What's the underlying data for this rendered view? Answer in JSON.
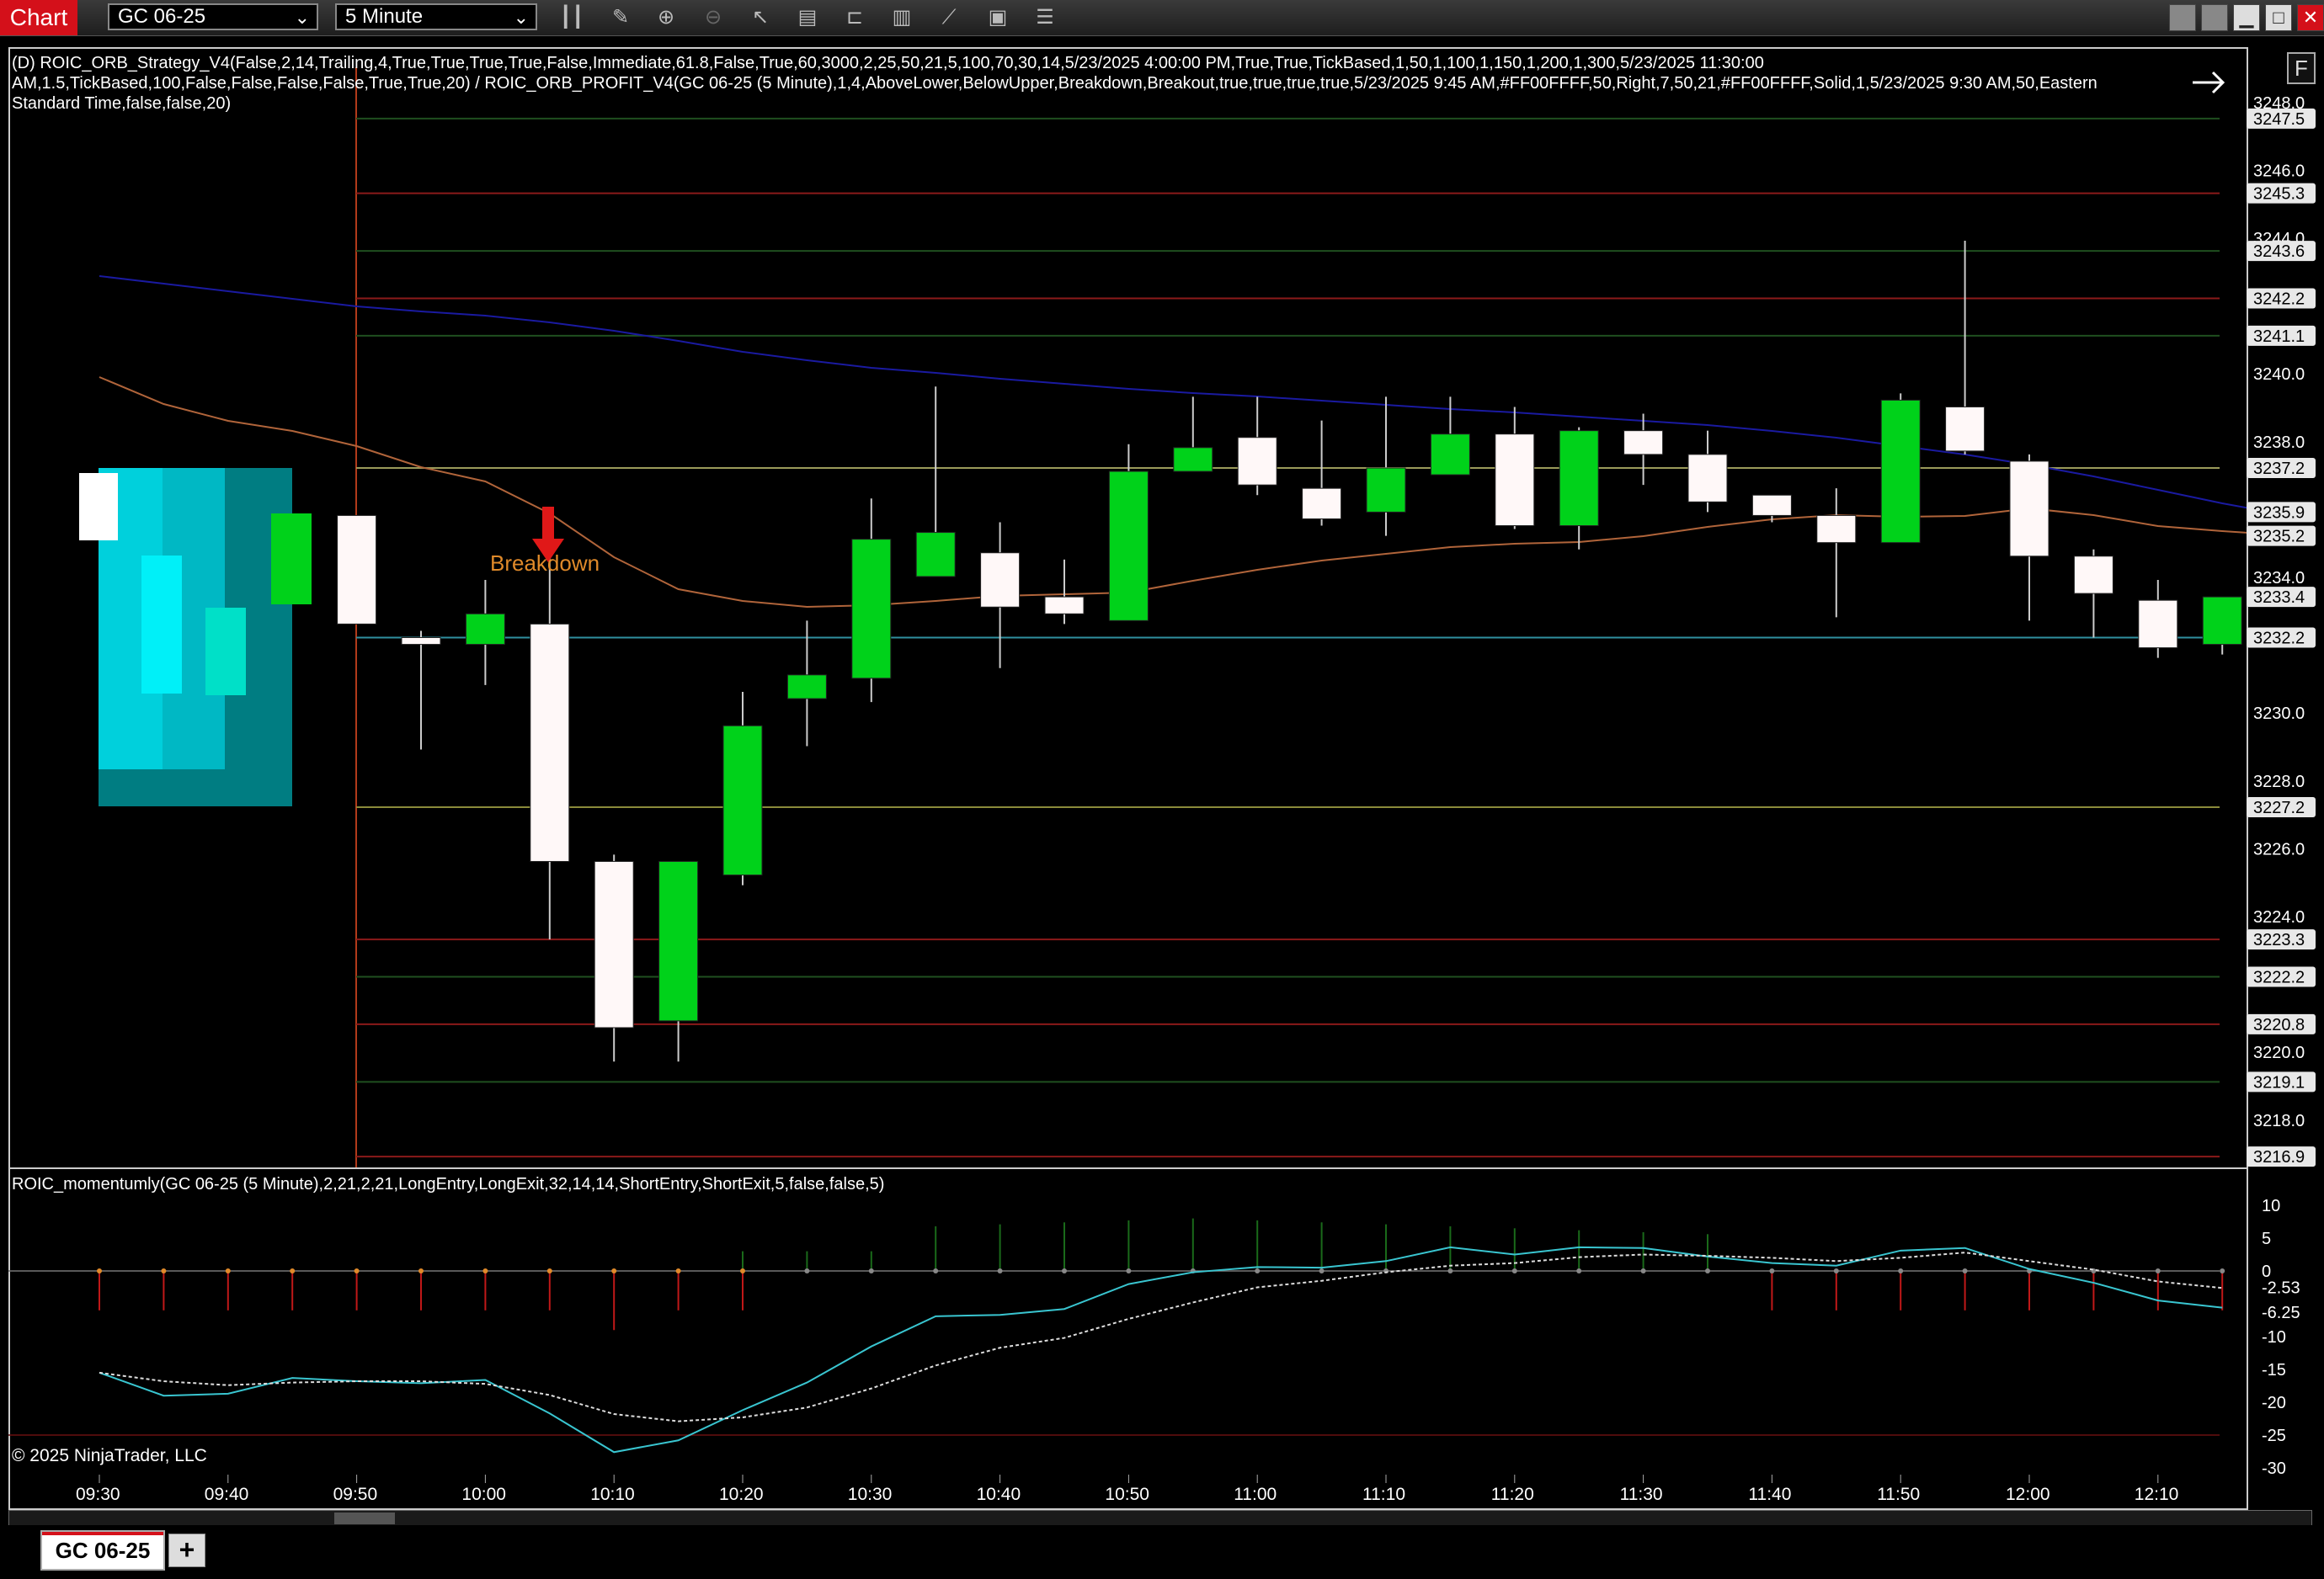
{
  "toolbar": {
    "chart_tab": "Chart",
    "instrument": "GC 06-25",
    "interval": "5 Minute",
    "icons": [
      "bar-type-icon",
      "draw-tool-icon",
      "zoom-in-icon",
      "zoom-out-icon",
      "pointer-icon",
      "data-box-icon",
      "templates-icon",
      "indicators-icon",
      "strategies-icon",
      "properties-icon",
      "menu-icon"
    ]
  },
  "window_buttons": [
    "tile",
    "restore",
    "minimize",
    "maximize",
    "close"
  ],
  "f_button": "F",
  "strategy_label_1": "(D) ROIC_ORB_Strategy_V4(False,2,14,Trailing,4,True,True,True,True,False,Immediate,61.8,False,True,60,3000,2,25,50,21,5,100,70,30,14,5/23/2025 4:00:00 PM,True,True,TickBased,1,50,1,100,1,150,1,200,1,300,5/23/2025 11:30:00",
  "strategy_label_2": "AM,1.5,TickBased,100,False,False,False,False,True,True,20) / ROIC_ORB_PROFIT_V4(GC 06-25 (5 Minute),1,4,AboveLower,BelowUpper,Breakdown,Breakout,true,true,true,true,5/23/2025 9:45 AM,#FF00FFFF,50,Right,7,50,21,#FF00FFFF,Solid,1,5/23/2025 9:30 AM,50,Eastern",
  "strategy_label_3": "Standard Time,false,false,20)",
  "indicator_label": "ROIC_momentumly(GC 06-25 (5 Minute),2,21,2,21,LongEntry,LongExit,32,14,14,ShortEntry,ShortExit,5,false,false,5)",
  "breakdown_label": "Breakdown",
  "copyright": "© 2025 NinjaTrader, LLC",
  "price_ticks": [
    "3248.0",
    "3246.0",
    "3244.0",
    "3240.0",
    "3238.0",
    "3234.0",
    "3230.0",
    "3228.0",
    "3226.0",
    "3224.0",
    "3220.0",
    "3218.0"
  ],
  "price_ticks_values": [
    3248.0,
    3246.0,
    3244.0,
    3240.0,
    3238.0,
    3234.0,
    3230.0,
    3228.0,
    3226.0,
    3224.0,
    3220.0,
    3218.0
  ],
  "level_labels": [
    "3247.5",
    "3245.3",
    "3243.6",
    "3242.2",
    "3241.1",
    "3237.2",
    "3235.9",
    "3235.2",
    "3233.4",
    "3232.2",
    "3227.2",
    "3223.3",
    "3222.2",
    "3220.8",
    "3219.1",
    "3216.9"
  ],
  "level_values": [
    3247.5,
    3245.3,
    3243.6,
    3242.2,
    3241.1,
    3237.2,
    3235.9,
    3235.2,
    3233.4,
    3232.2,
    3227.2,
    3223.3,
    3222.2,
    3220.8,
    3219.1,
    3216.9
  ],
  "osc_ticks": [
    "10",
    "5",
    "0",
    "-2.53",
    "-6.25",
    "-10",
    "-15",
    "-20",
    "-25",
    "-30"
  ],
  "osc_ticks_values": [
    10,
    5,
    0,
    -2.53,
    -6.25,
    -10,
    -15,
    -20,
    -25,
    -30
  ],
  "time_ticks": [
    "09:30",
    "09:40",
    "09:50",
    "10:00",
    "10:10",
    "10:20",
    "10:30",
    "10:40",
    "10:50",
    "11:00",
    "11:10",
    "11:20",
    "11:30",
    "11:40",
    "11:50",
    "12:00",
    "12:10"
  ],
  "tab": {
    "symbol": "GC 06-25",
    "add": "+"
  },
  "colors": {
    "bull": "#00d21a",
    "bear": "#fff8f8",
    "ema_slow": "#1a1aa0",
    "ema_fast": "#b0643a",
    "cyan_line": "#39c5d0",
    "arrow": "#e01818",
    "breakdown_text": "#e08a2a",
    "red_level": "#8b1a1a",
    "green_level": "#1f4f1f"
  },
  "chart_data": {
    "type": "candlestick",
    "x": [
      "09:30",
      "09:35",
      "09:40",
      "09:45",
      "09:50",
      "09:55",
      "10:00",
      "10:05",
      "10:10",
      "10:15",
      "10:20",
      "10:25",
      "10:30",
      "10:35",
      "10:40",
      "10:45",
      "10:50",
      "10:55",
      "11:00",
      "11:05",
      "11:10",
      "11:15",
      "11:20",
      "11:25",
      "11:30",
      "11:35",
      "11:40",
      "11:45",
      "11:50",
      "11:55",
      "12:00",
      "12:05",
      "12:10",
      "12:15"
    ],
    "candles": [
      {
        "t": "09:50",
        "o": 3235.8,
        "h": 3235.8,
        "l": 3232.6,
        "c": 3232.6
      },
      {
        "t": "09:55",
        "o": 3232.2,
        "h": 3232.4,
        "l": 3228.9,
        "c": 3232.0
      },
      {
        "t": "10:00",
        "o": 3232.0,
        "h": 3233.9,
        "l": 3230.8,
        "c": 3232.9
      },
      {
        "t": "10:05",
        "o": 3232.6,
        "h": 3235.6,
        "l": 3223.3,
        "c": 3225.6
      },
      {
        "t": "10:10",
        "o": 3225.6,
        "h": 3225.8,
        "l": 3219.7,
        "c": 3220.7
      },
      {
        "t": "10:15",
        "o": 3220.9,
        "h": 3225.6,
        "l": 3219.7,
        "c": 3225.6
      },
      {
        "t": "10:20",
        "o": 3225.2,
        "h": 3230.6,
        "l": 3224.9,
        "c": 3229.6
      },
      {
        "t": "10:25",
        "o": 3230.4,
        "h": 3232.7,
        "l": 3229.0,
        "c": 3231.1
      },
      {
        "t": "10:30",
        "o": 3231.0,
        "h": 3236.3,
        "l": 3230.3,
        "c": 3235.1
      },
      {
        "t": "10:35",
        "o": 3234.0,
        "h": 3239.6,
        "l": 3234.0,
        "c": 3235.3
      },
      {
        "t": "10:40",
        "o": 3234.7,
        "h": 3235.6,
        "l": 3231.3,
        "c": 3233.1
      },
      {
        "t": "10:45",
        "o": 3233.4,
        "h": 3234.5,
        "l": 3232.6,
        "c": 3232.9
      },
      {
        "t": "10:50",
        "o": 3232.7,
        "h": 3237.9,
        "l": 3232.7,
        "c": 3237.1
      },
      {
        "t": "10:55",
        "o": 3237.1,
        "h": 3239.3,
        "l": 3237.1,
        "c": 3237.8
      },
      {
        "t": "11:00",
        "o": 3238.1,
        "h": 3239.3,
        "l": 3236.4,
        "c": 3236.7
      },
      {
        "t": "11:05",
        "o": 3236.6,
        "h": 3238.6,
        "l": 3235.5,
        "c": 3235.7
      },
      {
        "t": "11:10",
        "o": 3235.9,
        "h": 3239.3,
        "l": 3235.2,
        "c": 3237.2
      },
      {
        "t": "11:15",
        "o": 3237.0,
        "h": 3239.3,
        "l": 3237.0,
        "c": 3238.2
      },
      {
        "t": "11:20",
        "o": 3238.2,
        "h": 3239.0,
        "l": 3235.4,
        "c": 3235.5
      },
      {
        "t": "11:25",
        "o": 3235.5,
        "h": 3238.4,
        "l": 3234.8,
        "c": 3238.3
      },
      {
        "t": "11:30",
        "o": 3238.3,
        "h": 3238.8,
        "l": 3236.7,
        "c": 3237.6
      },
      {
        "t": "11:35",
        "o": 3237.6,
        "h": 3238.3,
        "l": 3235.9,
        "c": 3236.2
      },
      {
        "t": "11:40",
        "o": 3236.4,
        "h": 3236.4,
        "l": 3235.6,
        "c": 3235.8
      },
      {
        "t": "11:45",
        "o": 3235.8,
        "h": 3236.6,
        "l": 3232.8,
        "c": 3235.0
      },
      {
        "t": "11:50",
        "o": 3235.0,
        "h": 3239.4,
        "l": 3235.0,
        "c": 3239.2
      },
      {
        "t": "11:55",
        "o": 3239.0,
        "h": 3243.9,
        "l": 3237.6,
        "c": 3237.7
      },
      {
        "t": "12:00",
        "o": 3237.4,
        "h": 3237.6,
        "l": 3232.7,
        "c": 3234.6
      },
      {
        "t": "12:05",
        "o": 3234.6,
        "h": 3234.8,
        "l": 3232.2,
        "c": 3233.5
      },
      {
        "t": "12:10",
        "o": 3233.3,
        "h": 3233.9,
        "l": 3231.6,
        "c": 3231.9
      },
      {
        "t": "12:15",
        "o": 3232.0,
        "h": 3233.4,
        "l": 3231.7,
        "c": 3233.4
      }
    ],
    "ylim": [
      3216.2,
      3249.0
    ],
    "oscillator": {
      "ylim": [
        -31,
        12
      ],
      "cyan": [
        -15.5,
        -19,
        -18.7,
        -16.3,
        -16.8,
        -17.1,
        -16.6,
        -21.7,
        -27.6,
        -25.8,
        -21.2,
        -17.0,
        -11.5,
        -6.9,
        -6.7,
        -5.8,
        -2.0,
        -0.2,
        0.6,
        0.5,
        1.5,
        3.6,
        2.5,
        3.6,
        3.5,
        2.2,
        1.2,
        0.8,
        3.1,
        3.5,
        0.3,
        -1.8,
        -4.5,
        -5.6
      ],
      "white": [
        -15.5,
        -16.8,
        -17.4,
        -17.0,
        -16.8,
        -16.8,
        -17.2,
        -18.9,
        -21.8,
        -22.9,
        -22.3,
        -20.8,
        -17.9,
        -14.4,
        -11.7,
        -10.2,
        -7.3,
        -4.8,
        -2.5,
        -1.5,
        -0.2,
        0.8,
        1.2,
        2.1,
        2.5,
        2.3,
        2.0,
        1.5,
        2.0,
        2.8,
        1.5,
        0.2,
        -1.6,
        -2.6
      ]
    }
  }
}
